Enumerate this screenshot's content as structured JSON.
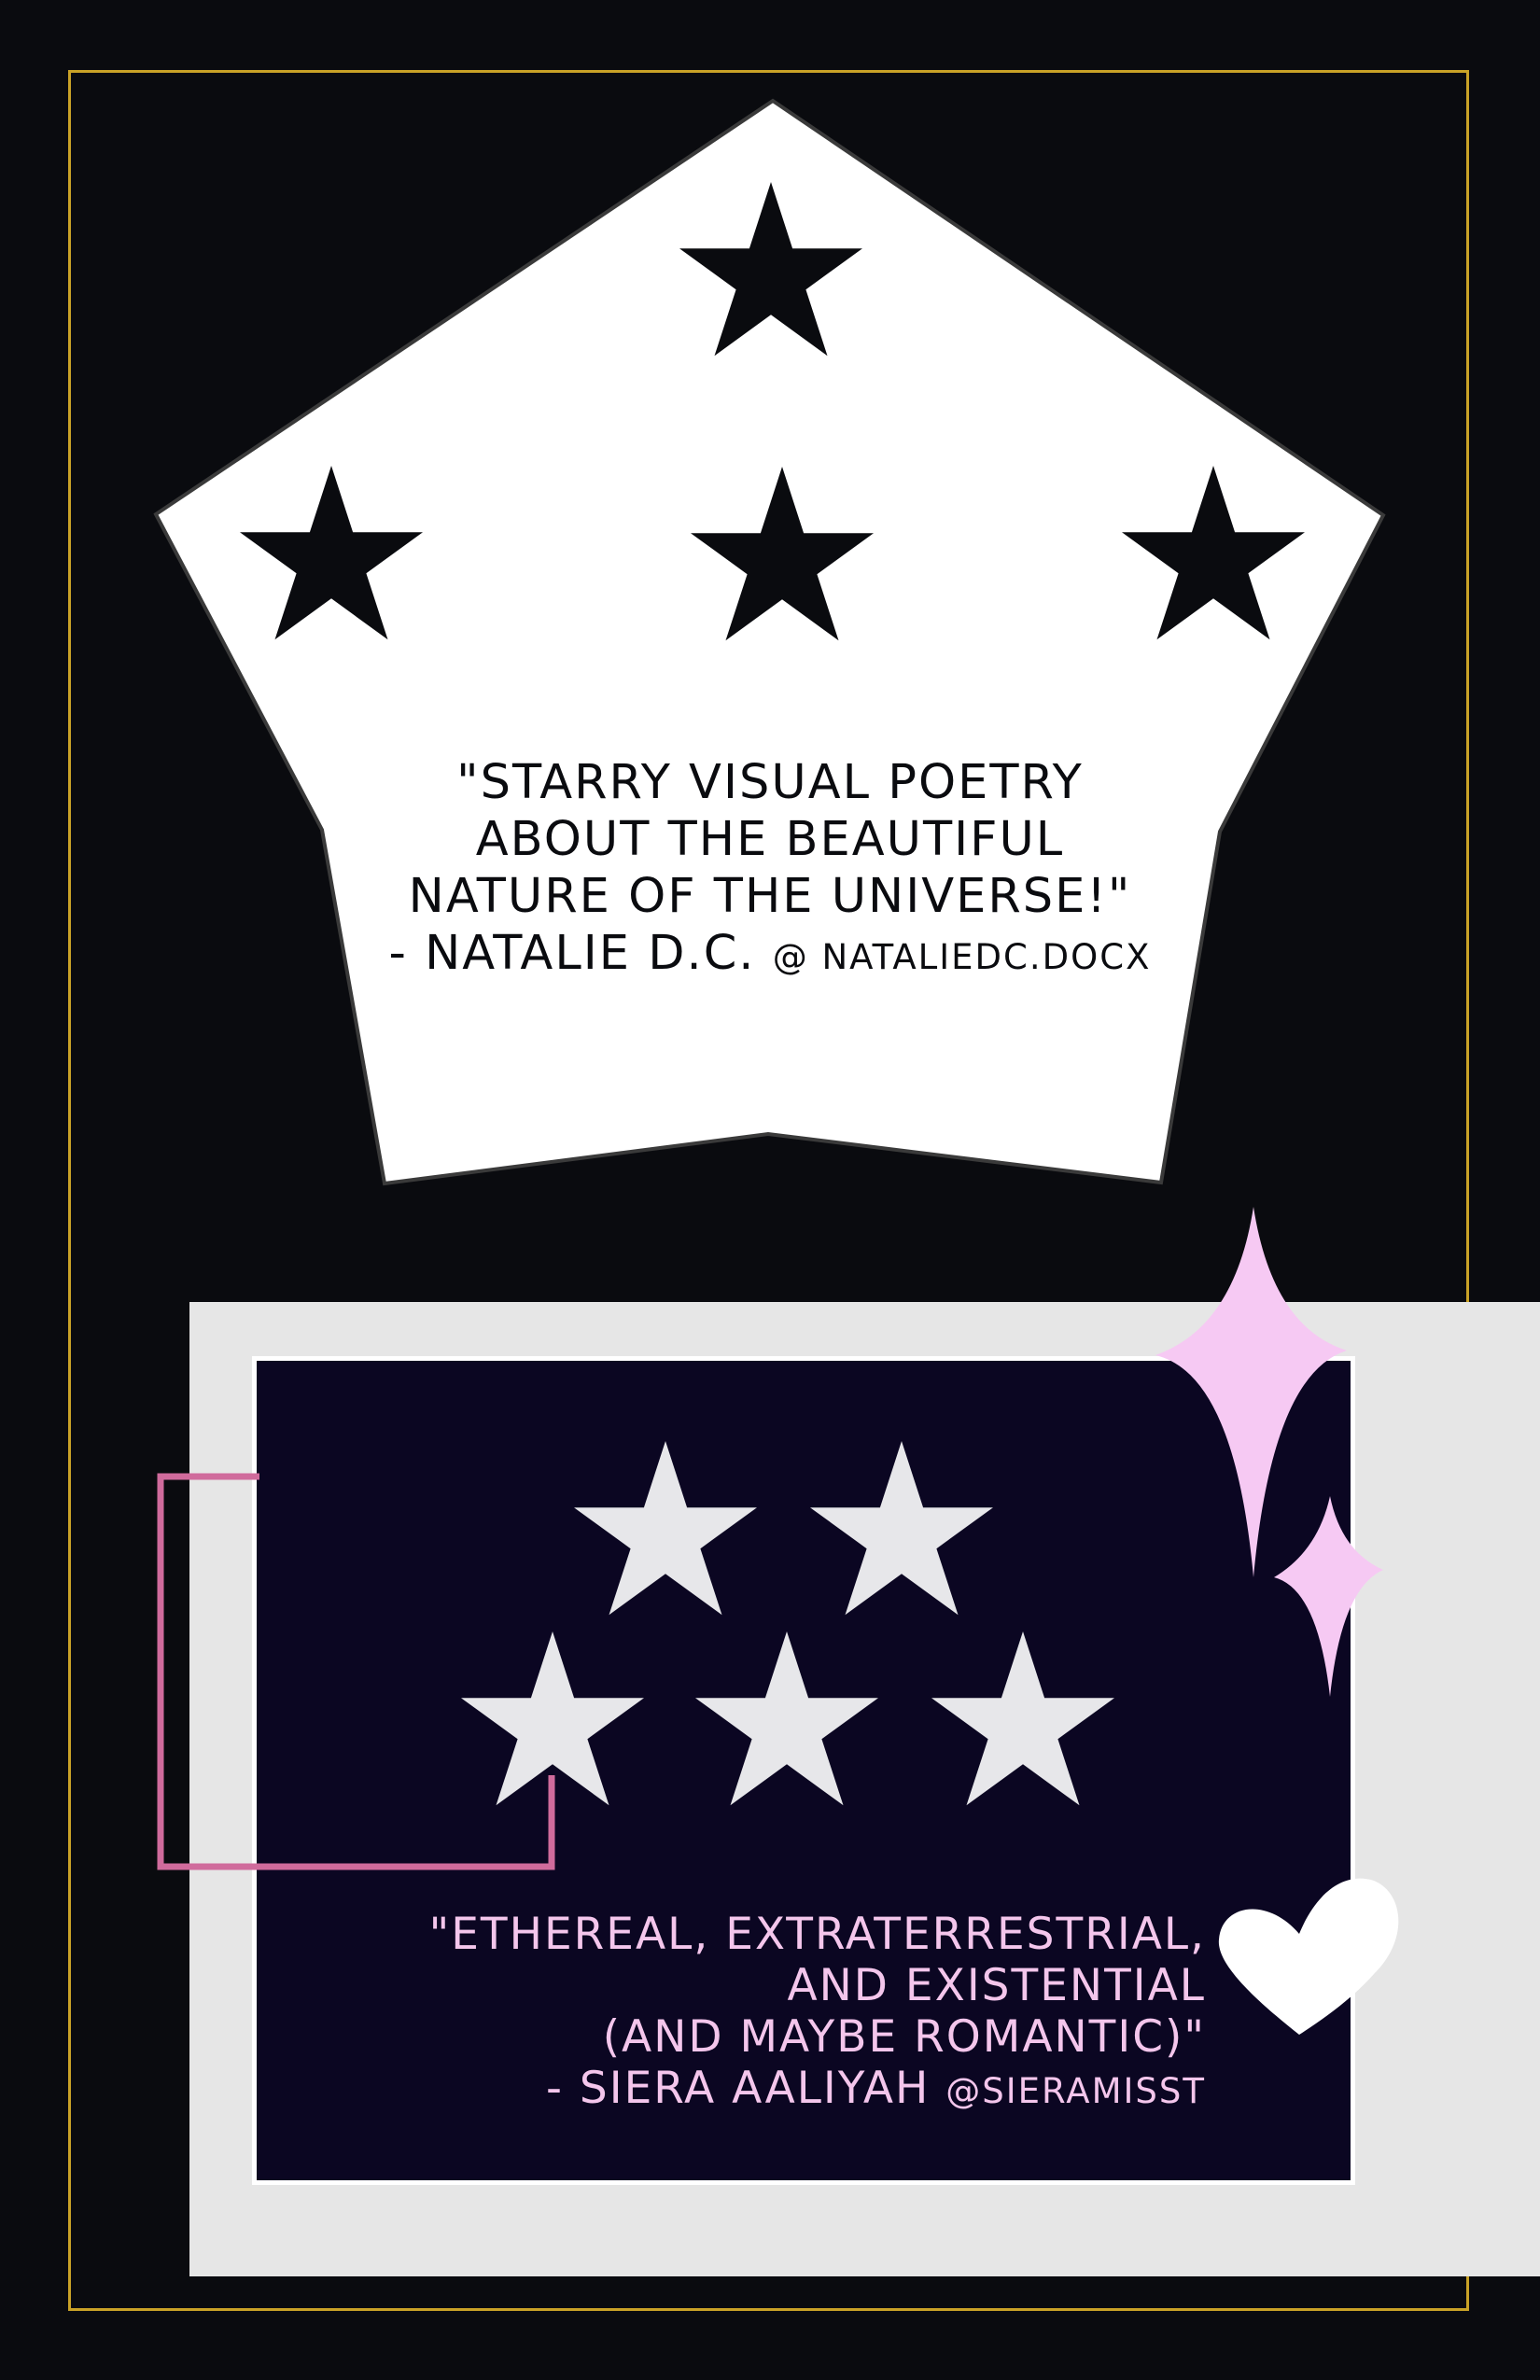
{
  "colors": {
    "background": "#0a0b0f",
    "frame_gold": "#c9a227",
    "pentagon_fill": "#ffffff",
    "star_black": "#0a0b0f",
    "panel_gray": "#e6e6e6",
    "panel_navy": "#0b0622",
    "star_light": "#e7e7ea",
    "sparkle_pink": "#f6c9f3",
    "bracket_pink": "#d06b9c",
    "quote_pink": "#f4c6ec",
    "heart_white": "#ffffff"
  },
  "icons": {
    "top_stars": "star-icon",
    "bottom_stars": "star-icon",
    "sparkles": "sparkle-icon",
    "heart": "heart-icon"
  },
  "top_quote": {
    "line1": "\"STARRY VISUAL POETRY",
    "line2": "ABOUT THE BEAUTIFUL",
    "line3": "NATURE OF THE UNIVERSE!\"",
    "author": "- NATALIE D.C.",
    "handle": "@ NATALIEDC.DOCX"
  },
  "bottom_quote": {
    "line1": "\"ETHEREAL, EXTRATERRESTRIAL,",
    "line2": "AND EXISTENTIAL",
    "line3": "(AND MAYBE ROMANTIC)\"",
    "author": "- SIERA AALIYAH",
    "handle": "@SIERAMISST"
  }
}
